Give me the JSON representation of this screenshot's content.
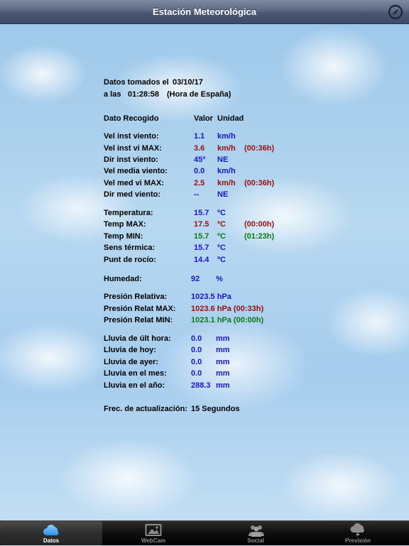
{
  "header": {
    "title": "Estación Meteorológica",
    "compass_icon": "compass-icon"
  },
  "meta": {
    "datos_label": "Datos tomados el",
    "date": "03/10/17",
    "time_label": "a las",
    "time": "01:28:58",
    "timezone": "(Hora de España)"
  },
  "columns": {
    "dato": "Dato Recogido",
    "valor": "Valor",
    "unidad": "Unidad"
  },
  "wind": {
    "vel_inst": {
      "label": "Vel inst viento:",
      "value": "1.1",
      "unit": "km/h"
    },
    "vel_inst_max": {
      "label": "Vel inst vi MAX:",
      "value": "3.6",
      "unit": "km/h",
      "time": "(00:36h)"
    },
    "dir_inst": {
      "label": "Dir inst viento:",
      "value": "45º",
      "unit": "NE"
    },
    "vel_media": {
      "label": "Vel media viento:",
      "value": "0.0",
      "unit": "km/h"
    },
    "vel_med_max": {
      "label": "Vel med vi MAX:",
      "value": "2.5",
      "unit": "km/h",
      "time": "(00:36h)"
    },
    "dir_med": {
      "label": "Dir med viento:",
      "value": "--",
      "unit": "NE"
    }
  },
  "temperature": {
    "temp": {
      "label": "Temperatura:",
      "value": "15.7",
      "unit": "ºC"
    },
    "temp_max": {
      "label": "Temp MAX:",
      "value": "17.5",
      "unit": "ºC",
      "time": "(00:00h)"
    },
    "temp_min": {
      "label": "Temp MIN:",
      "value": "15.7",
      "unit": "ºC",
      "time": "(01:23h)"
    },
    "sens": {
      "label": "Sens térmica:",
      "value": "15.7",
      "unit": "ºC"
    },
    "rocio": {
      "label": "Punt de rocío:",
      "value": "14.4",
      "unit": "ºC"
    }
  },
  "humidity": {
    "label": "Humedad:",
    "value": "92",
    "unit": "%"
  },
  "pressure": {
    "rel": {
      "label": "Presión Relativa:",
      "value": "1023.5 hPa"
    },
    "rel_max": {
      "label": "Presión Relat MAX:",
      "value": "1023.6 hPa (00:33h)"
    },
    "rel_min": {
      "label": "Presión Relat MIN:",
      "value": "1023.1 hPa (00:00h)"
    }
  },
  "rain": {
    "hora": {
      "label": "Lluvia de últ hora:",
      "value": "0.0",
      "unit": "mm"
    },
    "hoy": {
      "label": "Lluvia de hoy:",
      "value": "0.0",
      "unit": "mm"
    },
    "ayer": {
      "label": "Lluvia de ayer:",
      "value": "0.0",
      "unit": "mm"
    },
    "mes": {
      "label": "Lluvia en el mes:",
      "value": "0.0",
      "unit": "mm"
    },
    "anio": {
      "label": "Lluvia en el año:",
      "value": "288.3",
      "unit": "mm"
    }
  },
  "refresh": {
    "label": "Frec. de actualización:",
    "value": "15 Segundos"
  },
  "tabs": [
    {
      "label": "Datos",
      "icon": "cloud-icon",
      "active": true
    },
    {
      "label": "WebCam",
      "icon": "picture-icon",
      "active": false
    },
    {
      "label": "Social",
      "icon": "people-icon",
      "active": false
    },
    {
      "label": "Previsión",
      "icon": "storm-cloud-icon",
      "active": false
    }
  ],
  "colors": {
    "value_blue": "#1a14cc",
    "max_red": "#9b0d0d",
    "min_green": "#0e7a14",
    "nav_bar": "#4a5672",
    "tab_bar": "#000000"
  }
}
